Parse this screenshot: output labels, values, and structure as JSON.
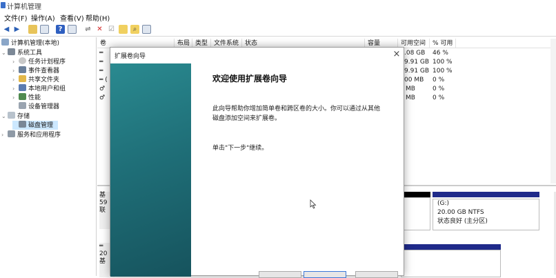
{
  "window": {
    "title": "计算机管理"
  },
  "menu": [
    "文件(F)",
    "操作(A)",
    "查看(V)",
    "帮助(H)"
  ],
  "toolbar_icons": [
    "back-icon",
    "forward-icon",
    "folder-up-icon",
    "properties-icon",
    "help-icon",
    "console-icon",
    "connect-icon",
    "delete-icon",
    "check-icon",
    "export-icon",
    "search-icon",
    "list-icon"
  ],
  "tree": {
    "root": "计算机管理(本地)",
    "system_tools": "系统工具",
    "task_scheduler": "任务计划程序",
    "event_viewer": "事件查看器",
    "shared_folders": "共享文件夹",
    "local_users": "本地用户和组",
    "performance": "性能",
    "device_manager": "设备管理器",
    "storage": "存储",
    "disk_management": "磁盘管理",
    "services": "服务和应用程序"
  },
  "volumes": {
    "headers": [
      "卷",
      "布局",
      "类型",
      "文件系统",
      "状态",
      "容量",
      "可用空间",
      "% 可用"
    ],
    "rows": [
      {
        "prefix": "═",
        "free": ".08 GB",
        "pct": "46 %"
      },
      {
        "prefix": "═",
        "free": "9.91 GB",
        "pct": "100 %"
      },
      {
        "prefix": "═",
        "free": "9.91 GB",
        "pct": "100 %"
      },
      {
        "prefix": "═ (",
        "free": "00 MB",
        "pct": "0 %"
      },
      {
        "prefix": "♂",
        "free": "MB",
        "pct": "0 %"
      },
      {
        "prefix": "♂",
        "free": "MB",
        "pct": "0 %"
      }
    ]
  },
  "disks": {
    "disk_a": {
      "l1": "基",
      "l2": "59",
      "l3": "联"
    },
    "disk_b": {
      "l1": "═",
      "l2": "20",
      "l3": "基"
    },
    "partition_g": {
      "name": "(G:)",
      "size": "20.00 GB NTFS",
      "status": "状态良好 (主分区)"
    }
  },
  "dialog": {
    "title": "扩展卷向导",
    "close": "×",
    "heading": "欢迎使用扩展卷向导",
    "description": "此向导帮助你增加简单卷和跨区卷的大小。你可以通过从其他磁盘添加空间来扩展卷。",
    "next_hint": "单击\"下一步\"继续。"
  },
  "colors": {
    "primary_partition": "#1f2a8a",
    "unallocated": "#000000",
    "wizard_banner": "#1f6f78"
  }
}
